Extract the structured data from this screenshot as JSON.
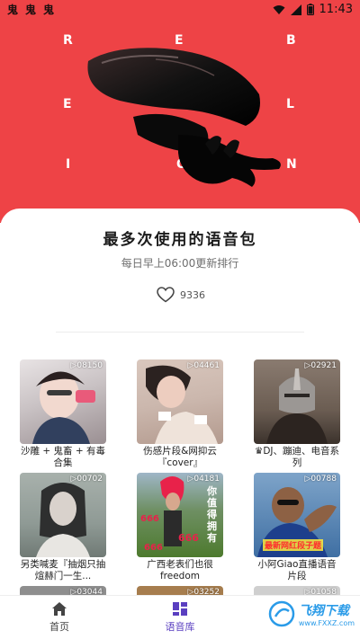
{
  "status_bar": {
    "time": "11:43",
    "app_icons": [
      "鬼",
      "鬼",
      "鬼"
    ],
    "icons": [
      "wifi-icon",
      "signal-icon",
      "battery-icon"
    ]
  },
  "hero": {
    "letters": [
      "R",
      "E",
      "B",
      "E",
      "L",
      "L",
      "I",
      "O",
      "N"
    ],
    "background_color": "#ee4346"
  },
  "card": {
    "title": "最多次使用的语音包",
    "subtitle": "每日早上06:00更新排行",
    "likes": "9336"
  },
  "tiles": [
    {
      "count": "▷08150",
      "caption": "沙雕 + 鬼畜 + 有毒合集",
      "color": "#c9c2c4"
    },
    {
      "count": "▷04461",
      "caption": "伤感片段&网抑云『cover』",
      "color": "#cbb7ad"
    },
    {
      "count": "▷02921",
      "caption": "♛DJ、蹦迪、电音系列",
      "color": "#6b5d52"
    },
    {
      "count": "▷00702",
      "caption": "另类喊麦『抽烟只抽煊赫门一生...",
      "color": "#8f9a95"
    },
    {
      "count": "▷04181",
      "caption": "广西老表们也很freedom",
      "color": "#4d7a2e"
    },
    {
      "count": "▷00788",
      "caption": "小阿Giao直播语音片段",
      "color": "#3f6fa3"
    },
    {
      "count": "▷03044",
      "caption": "",
      "color": "#8e8e8e"
    },
    {
      "count": "▷03252",
      "caption": "",
      "color": "#a67d4e"
    },
    {
      "count": "▷01058",
      "caption": "",
      "color": "#cfcfcf"
    }
  ],
  "overlay_texts": {
    "tile5_a": "666",
    "tile5_b": "666",
    "tile5_c": "666",
    "tile5_side": "你值得拥有",
    "tile6_banner": "最新网红段子题"
  },
  "bottom_nav": [
    {
      "label": "首页",
      "icon": "home-icon",
      "active": false
    },
    {
      "label": "语音库",
      "icon": "library-grid-icon",
      "active": true
    }
  ],
  "watermark": {
    "text": "飞翔下载",
    "sub": "www.FXXZ.com"
  },
  "colors": {
    "accent": "#5a3fc0",
    "brand_red": "#ee4346"
  }
}
